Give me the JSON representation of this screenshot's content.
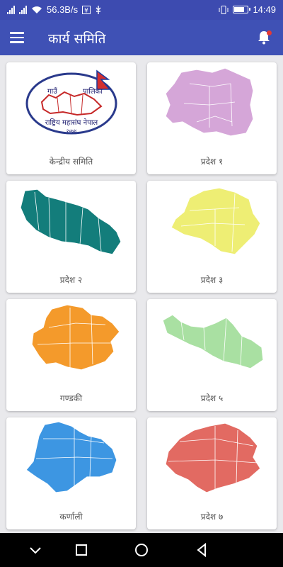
{
  "status_bar": {
    "speed": "56.3B/s",
    "time": "14:49"
  },
  "app_bar": {
    "title": "कार्य समिति",
    "menu_icon": "hamburger-menu-icon",
    "notification_icon": "bell-icon",
    "accent": "#3f51b5"
  },
  "cards": [
    {
      "label": "केन्द्रीय समिति",
      "image": "logo",
      "logo_text": {
        "top_left": "गाउँ",
        "top_right": "पालिका",
        "bottom": "राष्ट्रिय महासंघ नेपाल",
        "year": "२०७४"
      }
    },
    {
      "label": "प्रदेश १",
      "image": "map",
      "color": "#d5a6d8"
    },
    {
      "label": "प्रदेश २",
      "image": "map",
      "color": "#137d7b"
    },
    {
      "label": "प्रदेश ३",
      "image": "map",
      "color": "#eeee74"
    },
    {
      "label": "गण्डकी",
      "image": "map",
      "color": "#f49a2b"
    },
    {
      "label": "प्रदेश ५",
      "image": "map",
      "color": "#a9e0a2"
    },
    {
      "label": "कर्णाली",
      "image": "map",
      "color": "#3d96e2"
    },
    {
      "label": "प्रदेश ७",
      "image": "map",
      "color": "#e26a62"
    }
  ],
  "nav_bar": {
    "back_icon": "back-triangle-icon",
    "home_icon": "home-circle-icon",
    "recent_icon": "recent-square-icon",
    "down_icon": "chevron-down-icon"
  }
}
